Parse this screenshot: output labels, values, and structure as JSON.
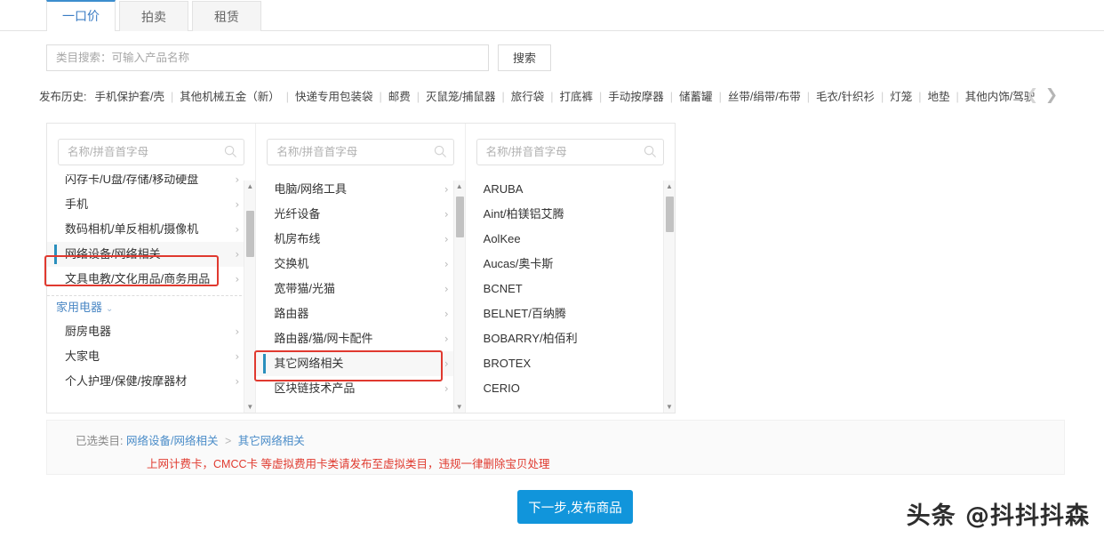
{
  "tabs": [
    {
      "label": "一口价",
      "active": true
    },
    {
      "label": "拍卖",
      "active": false
    },
    {
      "label": "租赁",
      "active": false
    }
  ],
  "search": {
    "placeholder": "类目搜索：可输入产品名称",
    "value": "",
    "button_label": "搜索"
  },
  "history": {
    "label": "发布历史:",
    "items": [
      "手机保护套/壳",
      "其他机械五金（新）",
      "快递专用包装袋",
      "邮费",
      "灭鼠笼/捕鼠器",
      "旅行袋",
      "打底裤",
      "手动按摩器",
      "储蓄罐",
      "丝带/绢带/布带",
      "毛衣/针织衫",
      "灯笼",
      "地垫",
      "其他内饰/驾驶"
    ],
    "prev_icon": "chevron-left-icon",
    "next_icon": "chevron-right-icon"
  },
  "picker": {
    "column_search_placeholder": "名称/拼音首字母",
    "columns": [
      {
        "name": "category-column-1",
        "items": [
          {
            "label": "闪存卡/U盘/存储/移动硬盘",
            "selected": false,
            "type": "item"
          },
          {
            "label": "手机",
            "selected": false,
            "type": "item"
          },
          {
            "label": "数码相机/单反相机/摄像机",
            "selected": false,
            "type": "item"
          },
          {
            "label": "网络设备/网络相关",
            "selected": true,
            "type": "item"
          },
          {
            "label": "文具电教/文化用品/商务用品",
            "selected": false,
            "type": "item"
          },
          {
            "label": "家用电器",
            "selected": false,
            "type": "group"
          },
          {
            "label": "厨房电器",
            "selected": false,
            "type": "item"
          },
          {
            "label": "大家电",
            "selected": false,
            "type": "item"
          },
          {
            "label": "个人护理/保健/按摩器材",
            "selected": false,
            "type": "item"
          }
        ]
      },
      {
        "name": "category-column-2",
        "items": [
          {
            "label": "电脑/网络工具",
            "selected": false,
            "type": "item"
          },
          {
            "label": "光纤设备",
            "selected": false,
            "type": "item"
          },
          {
            "label": "机房布线",
            "selected": false,
            "type": "item"
          },
          {
            "label": "交换机",
            "selected": false,
            "type": "item"
          },
          {
            "label": "宽带猫/光猫",
            "selected": false,
            "type": "item"
          },
          {
            "label": "路由器",
            "selected": false,
            "type": "item"
          },
          {
            "label": "路由器/猫/网卡配件",
            "selected": false,
            "type": "item"
          },
          {
            "label": "其它网络相关",
            "selected": true,
            "type": "item"
          },
          {
            "label": "区块链技术产品",
            "selected": false,
            "type": "item"
          }
        ]
      },
      {
        "name": "category-column-3",
        "items": [
          {
            "label": "ARUBA",
            "selected": false,
            "type": "plain"
          },
          {
            "label": "Aint/柏镁铝艾腾",
            "selected": false,
            "type": "plain"
          },
          {
            "label": "AolKee",
            "selected": false,
            "type": "plain"
          },
          {
            "label": "Aucas/奥卡斯",
            "selected": false,
            "type": "plain"
          },
          {
            "label": "BCNET",
            "selected": false,
            "type": "plain"
          },
          {
            "label": "BELNET/百纳腾",
            "selected": false,
            "type": "plain"
          },
          {
            "label": "BOBARRY/柏佰利",
            "selected": false,
            "type": "plain"
          },
          {
            "label": "BROTEX",
            "selected": false,
            "type": "plain"
          },
          {
            "label": "CERIO",
            "selected": false,
            "type": "plain"
          }
        ]
      }
    ]
  },
  "summary": {
    "label": "已选类目:",
    "crumbs": [
      "网络设备/网络相关",
      "其它网络相关"
    ],
    "separator": ">",
    "warning": "上网计费卡，CMCC卡 等虚拟费用卡类请发布至虚拟类目，违规一律删除宝贝处理"
  },
  "footer": {
    "next_button": "下一步,发布商品"
  },
  "watermark": "头条 @抖抖抖森",
  "colors": {
    "accent_blue": "#1195db",
    "tab_active": "#3c8ece",
    "annotation_red": "#e0392f",
    "warning_red": "#e03a2f",
    "link_blue": "#4a8cc8"
  }
}
